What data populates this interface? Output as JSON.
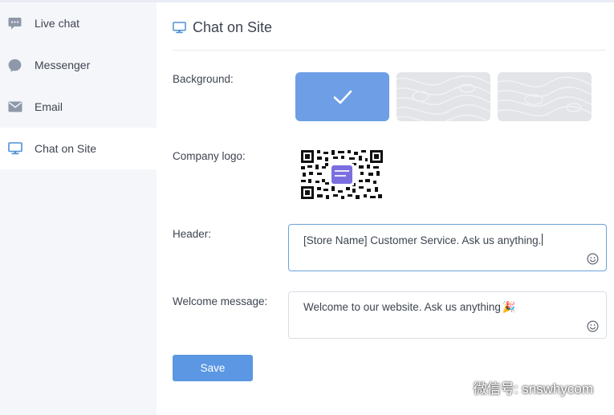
{
  "sidebar": {
    "items": [
      {
        "label": "Live chat",
        "icon": "chat-bubble-icon"
      },
      {
        "label": "Messenger",
        "icon": "messenger-icon"
      },
      {
        "label": "Email",
        "icon": "envelope-icon"
      },
      {
        "label": "Chat on Site",
        "icon": "monitor-icon",
        "active": true
      }
    ]
  },
  "main": {
    "title": "Chat on Site",
    "title_icon": "monitor-icon",
    "background": {
      "label": "Background:",
      "options": [
        "solid-blue",
        "pattern-light",
        "pattern-light"
      ],
      "selected_index": 0
    },
    "logo": {
      "label": "Company logo:",
      "icon": "qr-code-logo"
    },
    "header": {
      "label": "Header:",
      "value": "[Store Name] Customer Service. Ask us anything."
    },
    "welcome": {
      "label": "Welcome message:",
      "value": "Welcome to our website. Ask us anything",
      "emoji": "🎉"
    },
    "save_label": "Save"
  },
  "watermark": {
    "text": "微信号: snswhycom"
  },
  "colors": {
    "accent": "#5b97e2",
    "selected_tile": "#6d9ee6",
    "sidebar_bg": "#f5f6fa",
    "focus_border": "#6aa3dc",
    "icon_gray": "#8e98a8"
  }
}
